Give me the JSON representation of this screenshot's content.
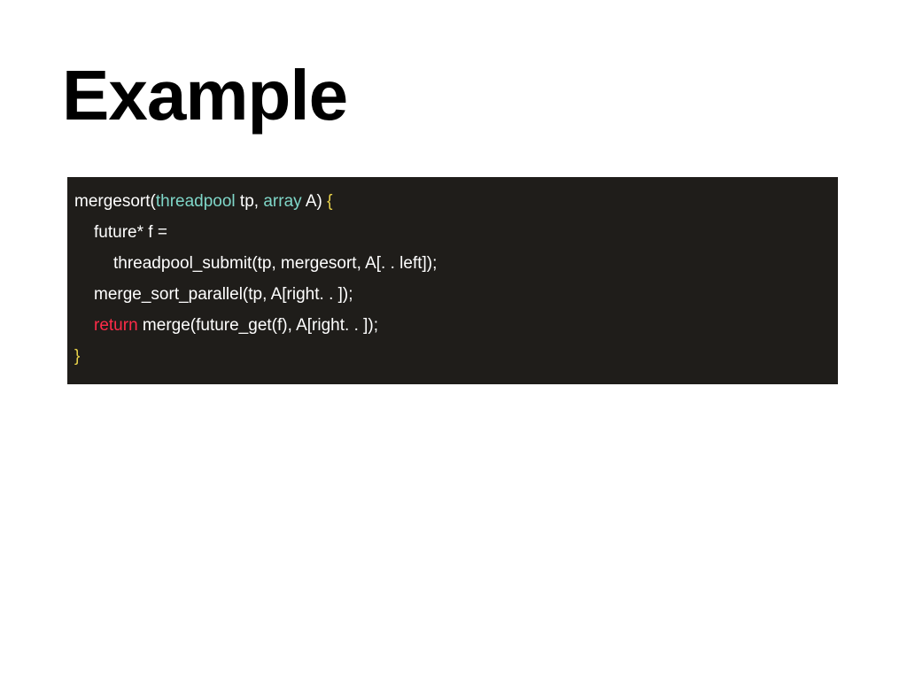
{
  "title": "Example",
  "code": {
    "l1_fn": "mergesort(",
    "l1_type1": "threadpool",
    "l1_mid": " tp, ",
    "l1_type2": "array",
    "l1_end": " A) ",
    "l1_brace": "{",
    "l2": "future* f =",
    "l3": "threadpool_submit(tp, mergesort, A[. . left]);",
    "l4": "merge_sort_parallel(tp, A[right. . ]);",
    "l5_ret": "return",
    "l5_rest": " merge(future_get(f), A[right. . ]);",
    "l6_brace": "}"
  }
}
